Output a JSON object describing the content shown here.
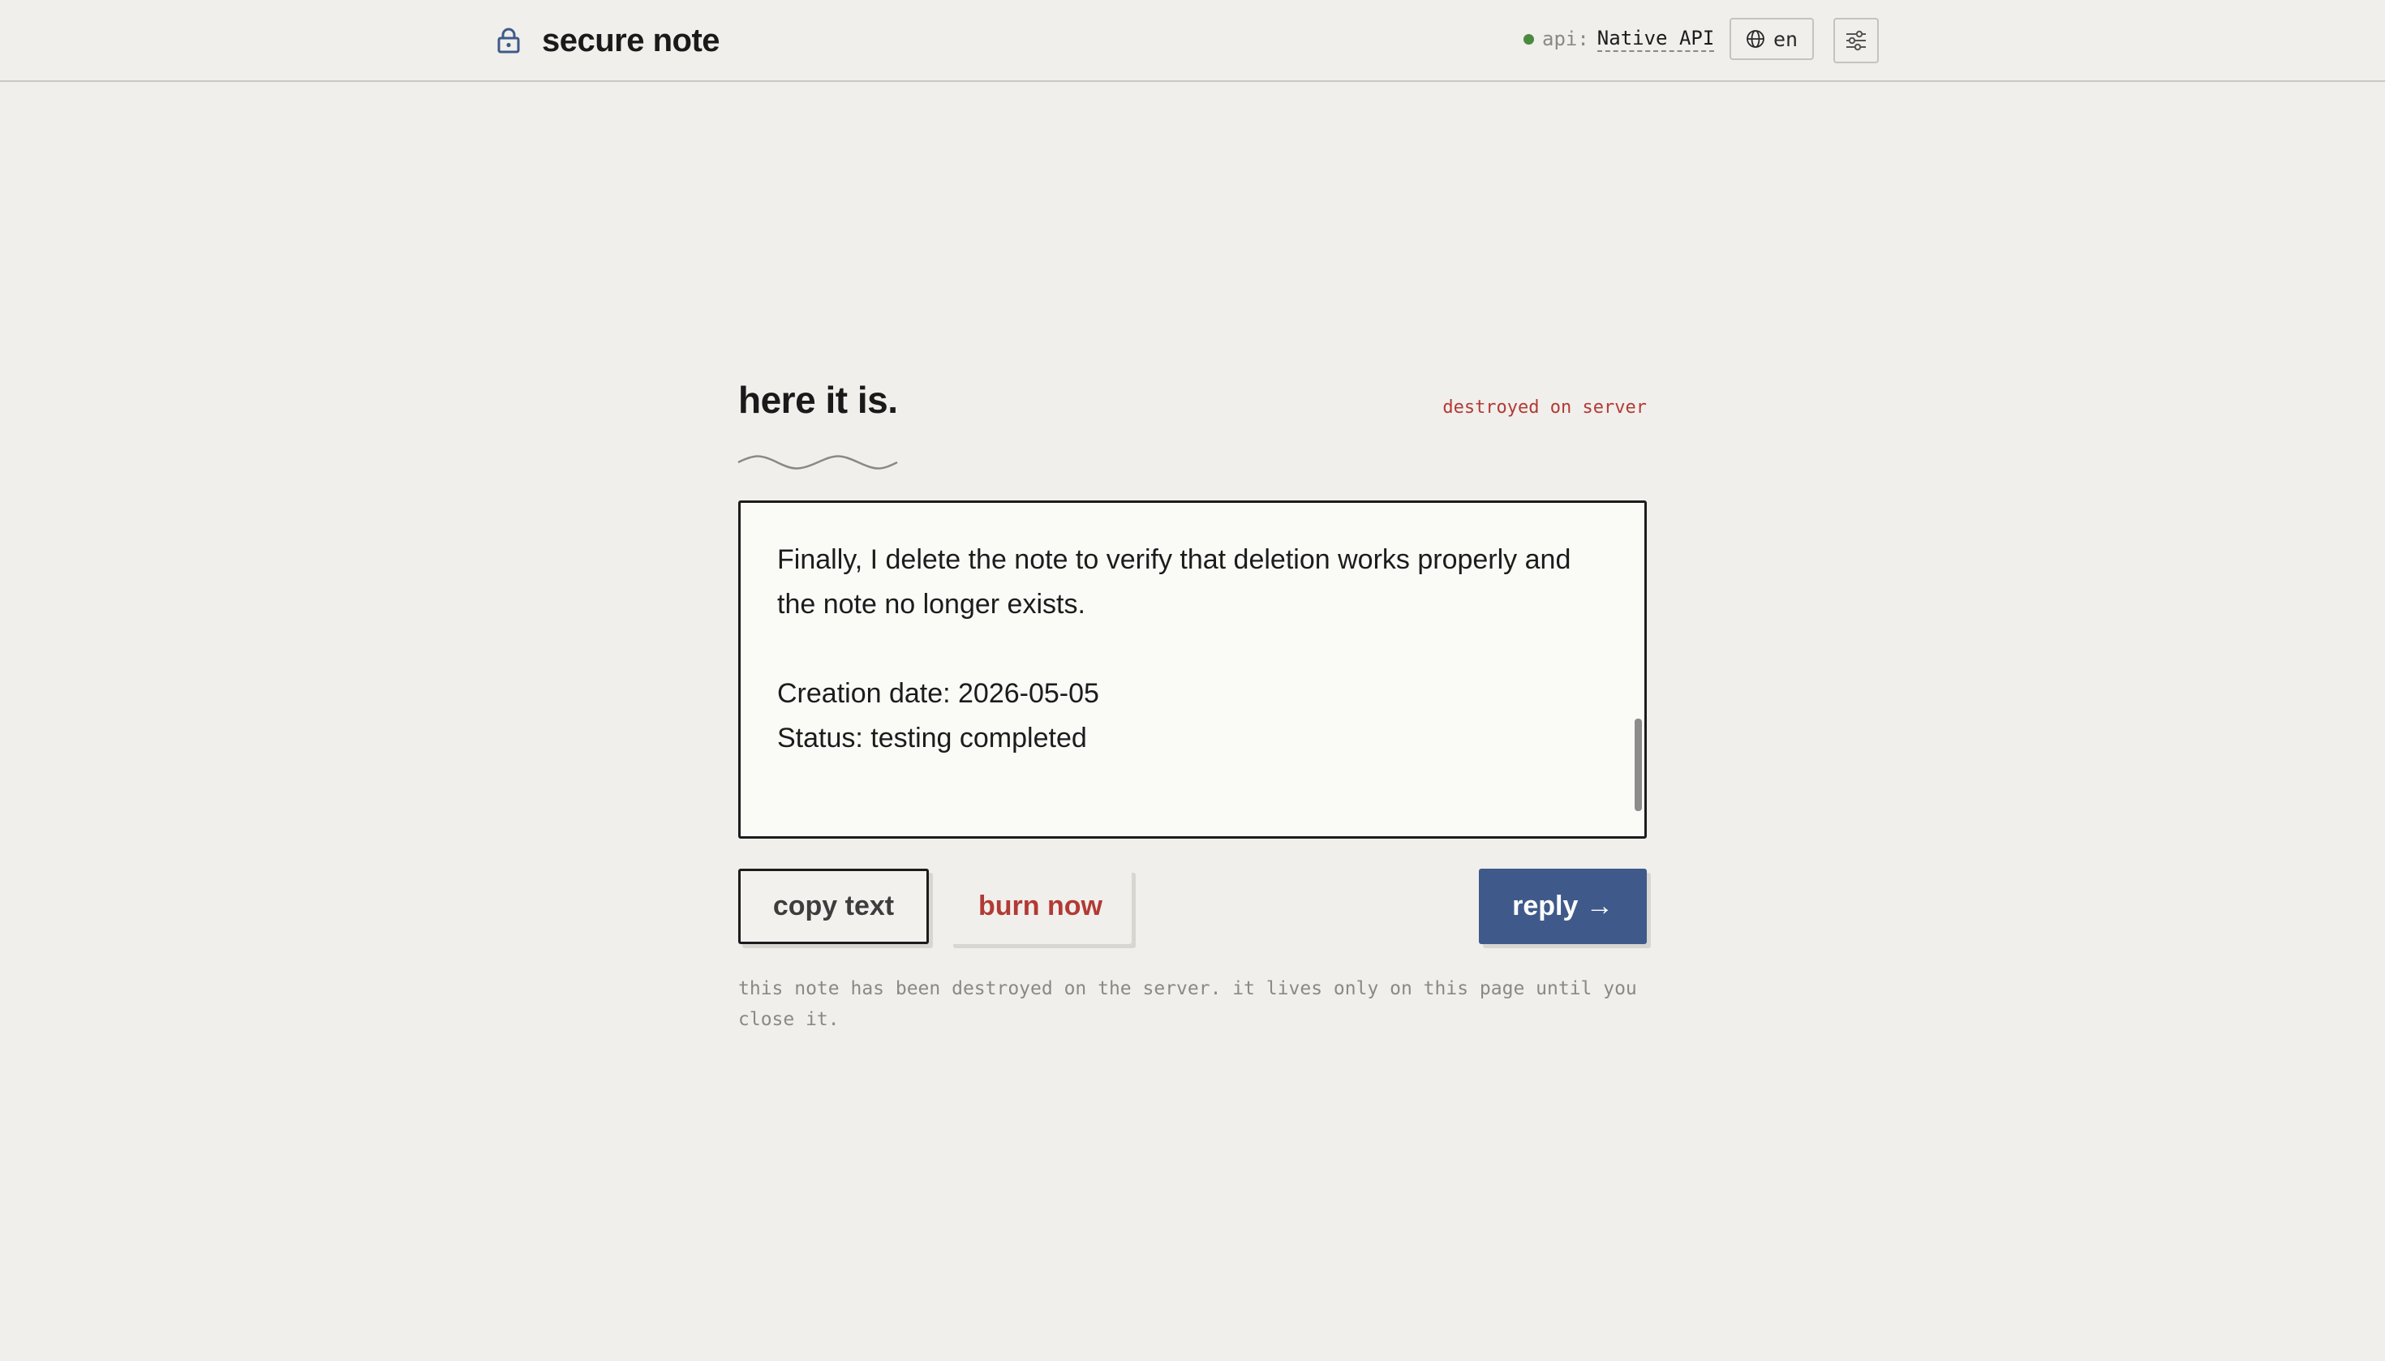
{
  "header": {
    "brand": "secure note",
    "api_label": "api:",
    "api_value": "Native API",
    "language": "en"
  },
  "note_view": {
    "heading": "here it is.",
    "status_tag": "destroyed on server",
    "content": "expect to see the exact same content without any loss.\n\nFinally, I delete the note to verify that deletion works properly and the note no longer exists.\n\nCreation date: 2026-05-05\nStatus: testing completed",
    "actions": {
      "copy": "copy text",
      "burn": "burn now",
      "reply": "reply →"
    },
    "footnote": "this note has been destroyed on the server. it lives only on this page until you close it."
  },
  "colors": {
    "background": "#f0efeb",
    "accent": "#3f5a8a",
    "danger": "#b23a35",
    "status_ok": "#4b8a3e"
  }
}
